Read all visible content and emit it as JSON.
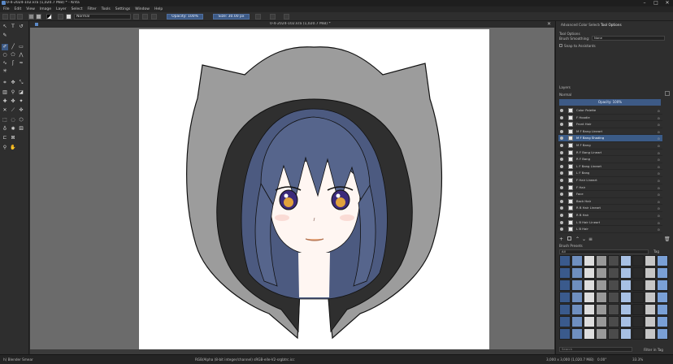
{
  "window": {
    "title": "0-4-2024-102.kra (1,020.7 MiB) * - Krita",
    "minimize": "–",
    "maximize": "□",
    "close": "✕"
  },
  "menu": [
    "File",
    "Edit",
    "View",
    "Image",
    "Layer",
    "Select",
    "Filter",
    "Tools",
    "Settings",
    "Window",
    "Help"
  ],
  "toolbar": {
    "blend_mode": "Normal",
    "opacity_label": "Opacity: 100%",
    "size_label": "Size: 30.00 px"
  },
  "document": {
    "tab_title": "0-4-2024-102.kra (1,020.7 MiB) *"
  },
  "dock": {
    "tabs": [
      "Advanced Color Selector",
      "Tool Options"
    ],
    "tool_options": {
      "smoothing_label": "Brush Smoothing:",
      "smoothing_value": "None",
      "snap_label": "Snap to Assistants"
    },
    "layers": {
      "title": "Layers",
      "blend_mode": "Normal",
      "opacity_label": "Opacity: 100%",
      "items": [
        {
          "name": "Color Palette",
          "selected": false
        },
        {
          "name": "F Hoodie",
          "selected": false
        },
        {
          "name": "Front Hair",
          "selected": false
        },
        {
          "name": "M F Bang Lineart",
          "selected": false
        },
        {
          "name": "M F Bang Shading",
          "selected": true
        },
        {
          "name": "M F Bang",
          "selected": false
        },
        {
          "name": "R F Bang Lineart",
          "selected": false
        },
        {
          "name": "R F Bang",
          "selected": false
        },
        {
          "name": "L F Bang Lineart",
          "selected": false
        },
        {
          "name": "L F Bang",
          "selected": false
        },
        {
          "name": "F Hair Lineart",
          "selected": false
        },
        {
          "name": "F Hair",
          "selected": false
        },
        {
          "name": "Face",
          "selected": false
        },
        {
          "name": "Back Hair",
          "selected": false
        },
        {
          "name": "R B Hair Lineart",
          "selected": false
        },
        {
          "name": "R B Hair",
          "selected": false
        },
        {
          "name": "L B Hair Lineart",
          "selected": false
        },
        {
          "name": "L B Hair",
          "selected": false
        }
      ]
    },
    "brush_presets": {
      "title": "Brush Presets",
      "filter": "All",
      "tag_label": "Tag",
      "search_label": "Search",
      "filter_in_tag": "Filter in Tag"
    }
  },
  "status": {
    "brush": "h) Blender Smear",
    "color_space": "RGB/Alpha (8-bit integer/channel) sRGB-elle-V2-srgbtrc.icc",
    "size": "3,000 x 3,000 (1,020.7 MiB)",
    "rotation": "0.00°",
    "zoom": "33.3%"
  },
  "colors": {
    "accent": "#3d5a86",
    "hood_outer": "#9c9c9c",
    "hood_inner": "#2f2f2f",
    "hair": "#56658c",
    "skin": "#fff6f2",
    "eye": "#3b2a7a"
  }
}
